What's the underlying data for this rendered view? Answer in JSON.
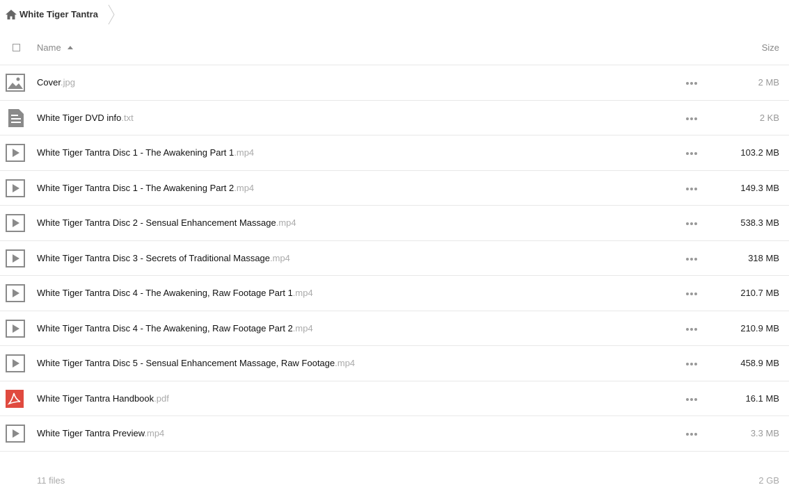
{
  "breadcrumb": {
    "home_icon": "home-icon",
    "folder": "White Tiger Tantra"
  },
  "header": {
    "name_label": "Name",
    "size_label": "Size",
    "sort_icon": "sort-ascending-icon"
  },
  "files": [
    {
      "name": "Cover",
      "ext": ".jpg",
      "icon": "image-icon",
      "size": "2 MB",
      "light": true
    },
    {
      "name": "White Tiger DVD info",
      "ext": ".txt",
      "icon": "text-file-icon",
      "size": "2 KB",
      "light": true
    },
    {
      "name": "White Tiger Tantra Disc 1 - The Awakening Part 1",
      "ext": ".mp4",
      "icon": "video-icon",
      "size": "103.2 MB",
      "light": false
    },
    {
      "name": "White Tiger Tantra Disc 1 - The Awakening Part 2",
      "ext": ".mp4",
      "icon": "video-icon",
      "size": "149.3 MB",
      "light": false
    },
    {
      "name": "White Tiger Tantra Disc 2 - Sensual Enhancement Massage",
      "ext": ".mp4",
      "icon": "video-icon",
      "size": "538.3 MB",
      "light": false
    },
    {
      "name": "White Tiger Tantra Disc 3 - Secrets of Traditional Massage",
      "ext": ".mp4",
      "icon": "video-icon",
      "size": "318 MB",
      "light": false
    },
    {
      "name": "White Tiger Tantra Disc 4 - The Awakening, Raw Footage Part 1",
      "ext": ".mp4",
      "icon": "video-icon",
      "size": "210.7 MB",
      "light": false
    },
    {
      "name": "White Tiger Tantra Disc 4 - The Awakening, Raw Footage Part 2",
      "ext": ".mp4",
      "icon": "video-icon",
      "size": "210.9 MB",
      "light": false
    },
    {
      "name": "White Tiger Tantra Disc 5 - Sensual Enhancement Massage, Raw Footage",
      "ext": ".mp4",
      "icon": "video-icon",
      "size": "458.9 MB",
      "light": false
    },
    {
      "name": "White Tiger Tantra Handbook",
      "ext": ".pdf",
      "icon": "pdf-icon",
      "size": "16.1 MB",
      "light": false
    },
    {
      "name": "White Tiger Tantra Preview",
      "ext": ".mp4",
      "icon": "video-icon",
      "size": "3.3 MB",
      "light": true
    }
  ],
  "footer": {
    "count": "11 files",
    "total": "2 GB"
  },
  "colors": {
    "pdf_red": "#e04a3f",
    "icon_gray": "#8a8a8a",
    "divider": "#e8e8e8"
  }
}
